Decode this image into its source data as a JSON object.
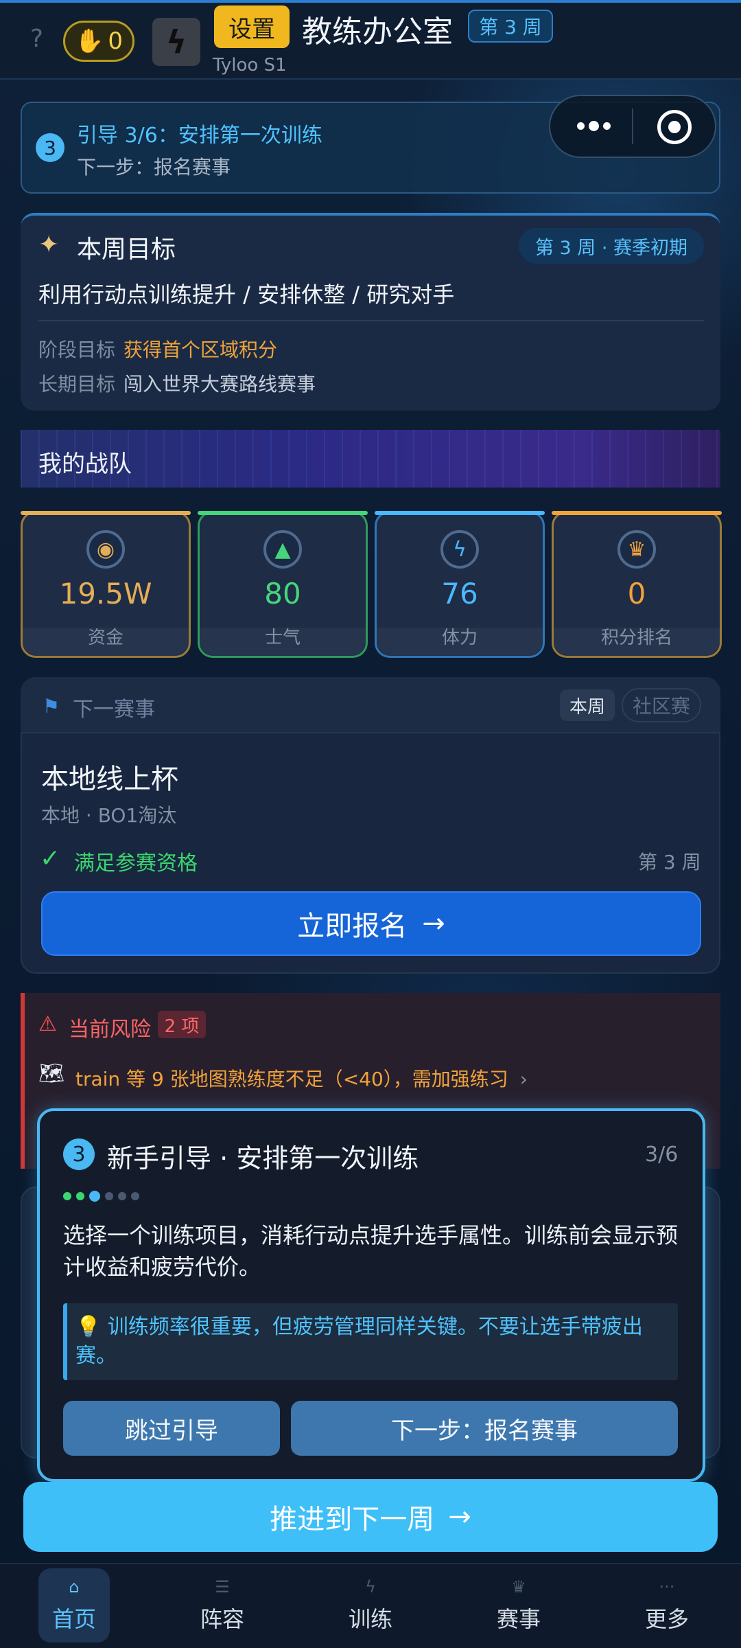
{
  "header": {
    "help_icon": "?",
    "action_points": "0",
    "settings_label": "设置",
    "title": "教练办公室",
    "week_badge": "第 3 周",
    "subtitle": "Tyloo  S1"
  },
  "guide_banner": {
    "step_number": "3",
    "title": "引导 3/6：安排第一次训练",
    "next": "下一步：报名赛事"
  },
  "weekly_goal": {
    "title": "本周目标",
    "badge": "第 3 周 · 赛季初期",
    "text": "利用行动点训练提升 / 安排休整 / 研究对手",
    "stage_label": "阶段目标",
    "stage_value": "获得首个区域积分",
    "long_label": "长期目标",
    "long_value": "闯入世界大赛路线赛事"
  },
  "team": {
    "title": "我的战队",
    "stats": [
      {
        "value": "19.5W",
        "label": "资金",
        "icon": "money-bag-icon",
        "color": "#e3ae55",
        "border": "#9c7a3a"
      },
      {
        "value": "80",
        "label": "士气",
        "icon": "flame-icon",
        "color": "#45d67a",
        "border": "#2f9a5c"
      },
      {
        "value": "76",
        "label": "体力",
        "icon": "lightning-icon",
        "color": "#4ab7ff",
        "border": "#2f76b8"
      },
      {
        "value": "0",
        "label": "积分排名",
        "icon": "trophy-icon",
        "color": "#f0a33a",
        "border": "#9c7a3a"
      }
    ]
  },
  "next_event": {
    "section_label": "下一赛事",
    "tag_week": "本周",
    "tag_community": "社区赛",
    "name": "本地线上杯",
    "meta": "本地  ·  BO1淘汰",
    "qualified": "满足参赛资格",
    "week": "第 3 周",
    "register_label": "立即报名",
    "register_arrow": "→"
  },
  "risk": {
    "title": "当前风险",
    "count": "2 项",
    "item": "train 等 9 张地图熟练度不足（<40），需加强练习",
    "item_arrow": "›"
  },
  "popup": {
    "step_number": "3",
    "title": "新手引导 · 安排第一次训练",
    "step": "3/6",
    "progress_total": 6,
    "progress_current": 3,
    "description": "选择一个训练项目，消耗行动点提升选手属性。训练前会显示预计收益和疲劳代价。",
    "tip": "训练频率很重要，但疲劳管理同样关键。不要让选手带疲出赛。",
    "skip_label": "跳过引导",
    "next_label": "下一步：报名赛事"
  },
  "advance": {
    "label": "推进到下一周",
    "arrow": "→"
  },
  "nav": {
    "items": [
      {
        "label": "首页",
        "icon": "home-icon",
        "active": true
      },
      {
        "label": "阵容",
        "icon": "roster-icon",
        "active": false
      },
      {
        "label": "训练",
        "icon": "training-icon",
        "active": false
      },
      {
        "label": "赛事",
        "icon": "trophy-icon",
        "active": false
      },
      {
        "label": "更多",
        "icon": "more-icon",
        "active": false
      }
    ]
  }
}
